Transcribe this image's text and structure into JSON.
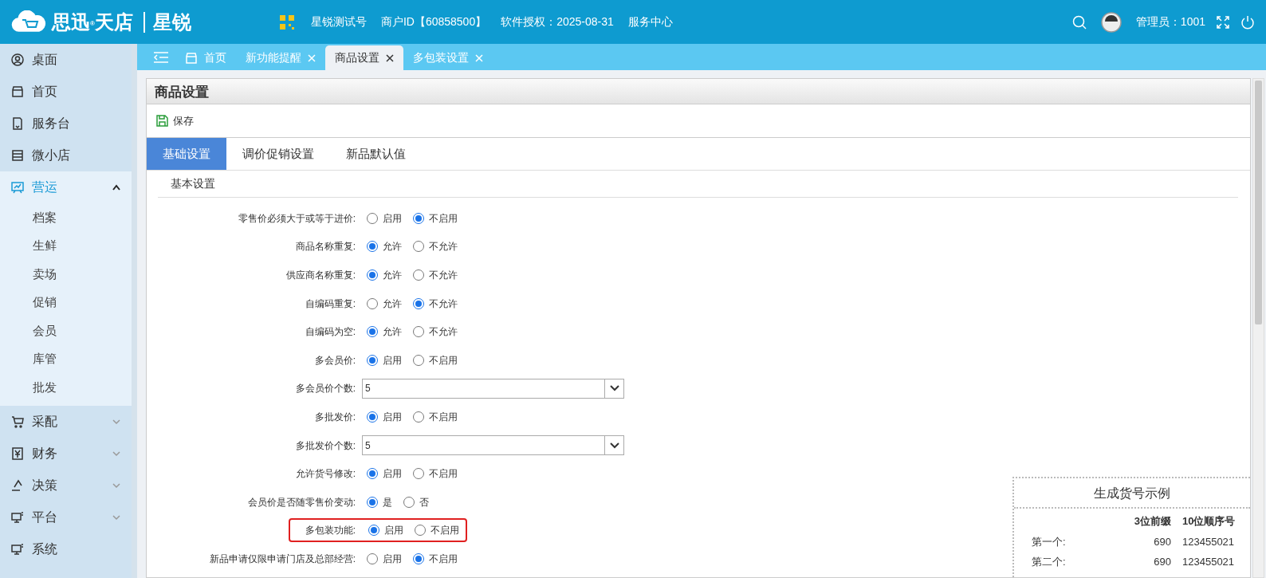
{
  "header": {
    "brand": "思迅",
    "brand_mark": "®",
    "brand_product": "天店",
    "brand_sub": "星锐",
    "store": "星锐测试号",
    "merchant_id": "商户ID【60858500】",
    "license": "软件授权：2025-08-31",
    "service": "服务中心",
    "admin": "管理员：1001"
  },
  "sidebar": {
    "items": [
      {
        "label": "桌面",
        "kind": "link",
        "selected": false
      },
      {
        "label": "首页",
        "kind": "link",
        "selected": false
      },
      {
        "label": "服务台",
        "kind": "link",
        "selected": false
      },
      {
        "label": "微小店",
        "kind": "link",
        "selected": false
      },
      {
        "label": "营运",
        "kind": "group",
        "selected": true,
        "expanded": true,
        "children": [
          {
            "label": "档案"
          },
          {
            "label": "生鲜"
          },
          {
            "label": "卖场"
          },
          {
            "label": "促销"
          },
          {
            "label": "会员"
          },
          {
            "label": "库管"
          },
          {
            "label": "批发"
          }
        ]
      },
      {
        "label": "采配",
        "kind": "group",
        "selected": false,
        "expanded": false
      },
      {
        "label": "财务",
        "kind": "group",
        "selected": false,
        "expanded": false
      },
      {
        "label": "决策",
        "kind": "group",
        "selected": false,
        "expanded": false
      },
      {
        "label": "平台",
        "kind": "group",
        "selected": false,
        "expanded": false
      },
      {
        "label": "系统",
        "kind": "link",
        "selected": false
      }
    ]
  },
  "tabs": [
    {
      "label": "首页",
      "kind": "home",
      "selected": false
    },
    {
      "label": "新功能提醒",
      "kind": "closable",
      "selected": false
    },
    {
      "label": "商品设置",
      "kind": "closable",
      "selected": true
    },
    {
      "label": "多包装设置",
      "kind": "closable",
      "selected": false
    }
  ],
  "panel": {
    "title": "商品设置",
    "save": "保存",
    "tabs": [
      {
        "label": "基础设置",
        "selected": true
      },
      {
        "label": "调价促销设置",
        "selected": false
      },
      {
        "label": "新品默认值",
        "selected": false
      }
    ],
    "section": "基本设置",
    "rows": [
      {
        "label": "零售价必须大于或等于进价:",
        "kind": "radio",
        "options": [
          {
            "label": "启用",
            "selected": false
          },
          {
            "label": "不启用",
            "selected": true
          }
        ]
      },
      {
        "label": "商品名称重复:",
        "kind": "radio",
        "options": [
          {
            "label": "允许",
            "selected": true
          },
          {
            "label": "不允许",
            "selected": false
          }
        ]
      },
      {
        "label": "供应商名称重复:",
        "kind": "radio",
        "options": [
          {
            "label": "允许",
            "selected": true
          },
          {
            "label": "不允许",
            "selected": false
          }
        ]
      },
      {
        "label": "自编码重复:",
        "kind": "radio",
        "options": [
          {
            "label": "允许",
            "selected": false
          },
          {
            "label": "不允许",
            "selected": true
          }
        ]
      },
      {
        "label": "自编码为空:",
        "kind": "radio",
        "options": [
          {
            "label": "允许",
            "selected": true
          },
          {
            "label": "不允许",
            "selected": false
          }
        ]
      },
      {
        "label": "多会员价:",
        "kind": "radio",
        "options": [
          {
            "label": "启用",
            "selected": true
          },
          {
            "label": "不启用",
            "selected": false
          }
        ]
      },
      {
        "label": "多会员价个数:",
        "kind": "select",
        "value": "5"
      },
      {
        "label": "多批发价:",
        "kind": "radio",
        "options": [
          {
            "label": "启用",
            "selected": true
          },
          {
            "label": "不启用",
            "selected": false
          }
        ]
      },
      {
        "label": "多批发价个数:",
        "kind": "select",
        "value": "5"
      },
      {
        "label": "允许货号修改:",
        "kind": "radio",
        "options": [
          {
            "label": "启用",
            "selected": true
          },
          {
            "label": "不启用",
            "selected": false
          }
        ]
      },
      {
        "label": "会员价是否随零售价变动:",
        "kind": "radio",
        "options": [
          {
            "label": "是",
            "selected": true
          },
          {
            "label": "否",
            "selected": false
          }
        ]
      },
      {
        "label": "多包装功能:",
        "kind": "radio",
        "highlighted": true,
        "options": [
          {
            "label": "启用",
            "selected": true
          },
          {
            "label": "不启用",
            "selected": false
          }
        ]
      },
      {
        "label": "新品申请仅限申请门店及总部经营:",
        "kind": "radio",
        "options": [
          {
            "label": "启用",
            "selected": false
          },
          {
            "label": "不启用",
            "selected": true
          }
        ]
      }
    ],
    "example": {
      "title": "生成货号示例",
      "columns": [
        "3位前缀",
        "10位顺序号"
      ],
      "rows": [
        {
          "name": "第一个:",
          "prefix": "690",
          "serial": "123455021"
        },
        {
          "name": "第二个:",
          "prefix": "690",
          "serial": "123455021"
        }
      ]
    }
  }
}
